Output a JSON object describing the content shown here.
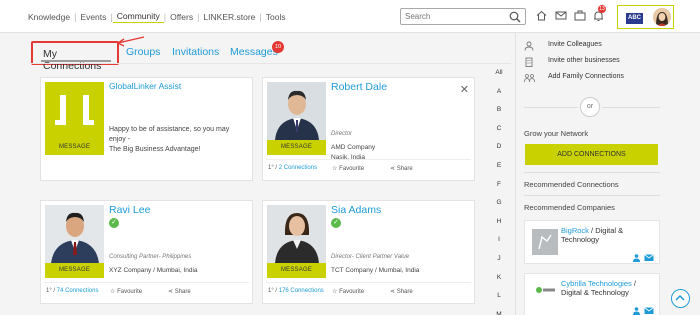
{
  "nav": {
    "items": [
      "Knowledge",
      "Events",
      "Community",
      "Offers",
      "LINKER.store",
      "Tools"
    ],
    "active": "Community"
  },
  "search": {
    "placeholder": "Search"
  },
  "notifications": {
    "count": "13"
  },
  "profile": {
    "badge": "ABC"
  },
  "tabs": {
    "my_connections": "My Connections",
    "groups": "Groups",
    "invitations": "Invitations",
    "messages": "Messages",
    "messages_badge": "10"
  },
  "cards": [
    {
      "name": "GlobalLinker Assist",
      "desc1": "Happy to be of assistance, so you may",
      "desc2": "enjoy -",
      "desc3": "The Big Business Advantage!",
      "message": "MESSAGE"
    },
    {
      "name": "Robert Dale",
      "role": "Director",
      "company": "AMD Company",
      "location": "Nasik, India",
      "degree": "1° / ",
      "connections": "2 Connections",
      "favourite": "Favourite",
      "share": "Share",
      "message": "MESSAGE"
    },
    {
      "name": "Ravi Lee",
      "role": "Consulting Partner- Philippines",
      "company": "XYZ Company",
      "location": "/ Mumbai, India",
      "degree": "1° / ",
      "connections": "74 Connections",
      "favourite": "Favourite",
      "share": "Share",
      "message": "MESSAGE"
    },
    {
      "name": "Sia Adams",
      "role": "Director- Client Partner Value",
      "company": "TCT Company",
      "location": "/ Mumbai, India",
      "degree": "1° / ",
      "connections": "176 Connections",
      "favourite": "Favourite",
      "share": "Share",
      "message": "MESSAGE"
    }
  ],
  "alphabet": [
    "All",
    "A",
    "B",
    "C",
    "D",
    "E",
    "F",
    "G",
    "H",
    "I",
    "J",
    "K",
    "L",
    "M"
  ],
  "sidebar": {
    "invite_colleagues": "Invite Colleagues",
    "invite_businesses": "Invite other businesses",
    "add_family": "Add Family Connections",
    "or": "or",
    "grow": "Grow your Network",
    "add_connections": "ADD CONNECTIONS",
    "recommended_connections": "Recommended Connections",
    "recommended_companies": "Recommended Companies",
    "companies": [
      {
        "name": "BigRock",
        "sector": " / Digital & Technology"
      },
      {
        "name": "Cybrilla Technologies",
        "sector": " / Digital & Technology"
      }
    ]
  },
  "colors": {
    "accent": "#c9d200",
    "link": "#1e9bd7",
    "highlight": "#e53935"
  }
}
